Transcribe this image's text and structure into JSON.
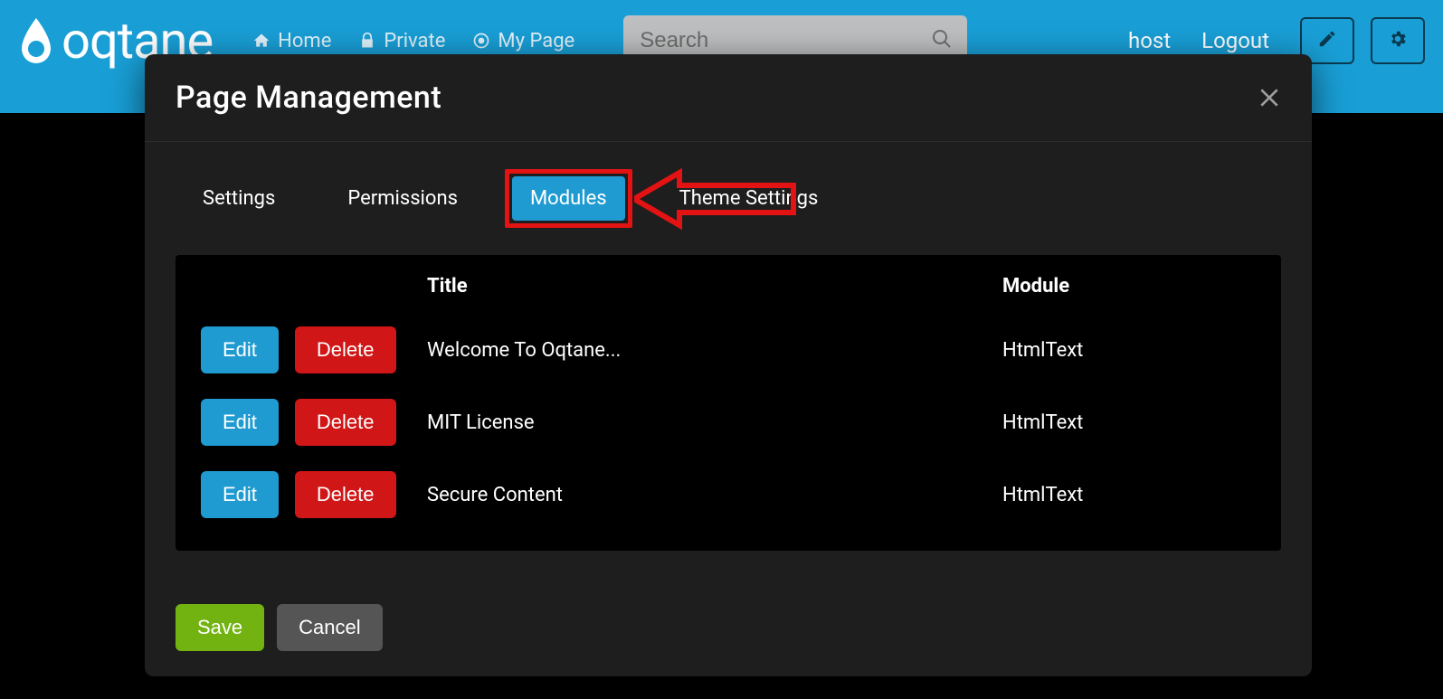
{
  "brand": "oqtane",
  "nav": {
    "home": "Home",
    "private": "Private",
    "mypage": "My Page"
  },
  "search": {
    "placeholder": "Search"
  },
  "user": {
    "name": "host",
    "logout": "Logout"
  },
  "modal": {
    "title": "Page Management",
    "tabs": {
      "settings": "Settings",
      "permissions": "Permissions",
      "modules": "Modules",
      "theme": "Theme Settings"
    },
    "table": {
      "headers": {
        "title": "Title",
        "module": "Module"
      },
      "rows": [
        {
          "edit": "Edit",
          "delete": "Delete",
          "title": "Welcome To Oqtane...",
          "module": "HtmlText"
        },
        {
          "edit": "Edit",
          "delete": "Delete",
          "title": "MIT License",
          "module": "HtmlText"
        },
        {
          "edit": "Edit",
          "delete": "Delete",
          "title": "Secure Content",
          "module": "HtmlText"
        }
      ]
    },
    "footer": {
      "save": "Save",
      "cancel": "Cancel"
    }
  }
}
